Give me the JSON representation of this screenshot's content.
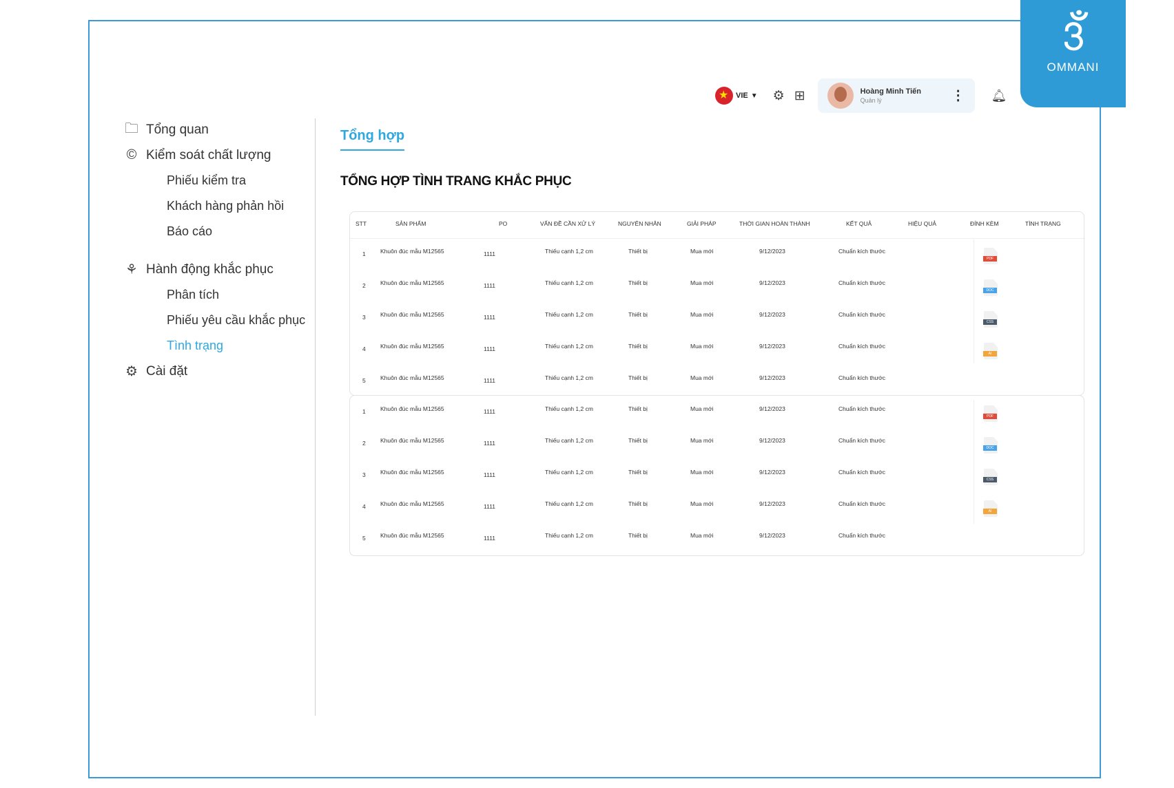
{
  "brand": {
    "mark": "3ઁ",
    "name": "OMMANI",
    "color": "#2f9bd6"
  },
  "topbar": {
    "language": "VIE",
    "user_name": "Hoàng Minh Tiến",
    "user_role": "Quản lý"
  },
  "sidebar": {
    "overview": "Tổng quan",
    "quality": "Kiểm soát chất lượng",
    "quality_items": [
      "Phiếu kiểm tra",
      "Khách hàng phản hồi",
      "Báo cáo"
    ],
    "corrective": "Hành động khắc phục",
    "corrective_items": [
      "Phân tích",
      "Phiếu yêu cầu khắc phục",
      "Tình trạng"
    ],
    "settings": "Cài đặt"
  },
  "main": {
    "tab": "Tổng hợp",
    "title": "TỔNG HỢP TÌNH TRANG KHẮC PHỤC",
    "columns": [
      "STT",
      "SẢN PHẨM",
      "PO",
      "VẤN ĐỀ CẦN XỬ LÝ",
      "NGUYÊN NHÂN",
      "GIẢI PHÁP",
      "THỜI GIAN HOÀN THÀNH",
      "KẾT QUẢ",
      "HIỆU QUẢ",
      "ĐÍNH KÈM",
      "TÌNH TRẠNG"
    ],
    "rows": [
      {
        "stt": "1",
        "product": "Khuôn đúc mẫu M12565",
        "po": "1111",
        "issue": "Thiếu cạnh 1,2 cm",
        "cause": "Thiết bị",
        "solution": "Mua mới",
        "time": "9/12/2023",
        "result": "Chuẩn kích thước",
        "file": "PDF"
      },
      {
        "stt": "2",
        "product": "Khuôn đúc mẫu M12565",
        "po": "1111",
        "issue": "Thiếu cạnh 1,2 cm",
        "cause": "Thiết bị",
        "solution": "Mua mới",
        "time": "9/12/2023",
        "result": "Chuẩn kích thước",
        "file": "DOC"
      },
      {
        "stt": "3",
        "product": "Khuôn đúc mẫu M12565",
        "po": "1111",
        "issue": "Thiếu cạnh 1,2 cm",
        "cause": "Thiết bị",
        "solution": "Mua mới",
        "time": "9/12/2023",
        "result": "Chuẩn kích thước",
        "file": "CSS"
      },
      {
        "stt": "4",
        "product": "Khuôn đúc mẫu M12565",
        "po": "1111",
        "issue": "Thiếu cạnh 1,2 cm",
        "cause": "Thiết bị",
        "solution": "Mua mới",
        "time": "9/12/2023",
        "result": "Chuẩn kích thước",
        "file": "AI"
      },
      {
        "stt": "5",
        "product": "Khuôn đúc mẫu M12565",
        "po": "1111",
        "issue": "Thiếu cạnh 1,2 cm",
        "cause": "Thiết bị",
        "solution": "Mua mới",
        "time": "9/12/2023",
        "result": "Chuẩn kích thước",
        "file": ""
      }
    ],
    "rows2": [
      {
        "stt": "1",
        "product": "Khuôn đúc mẫu M12565",
        "po": "1111",
        "issue": "Thiếu cạnh 1,2 cm",
        "cause": "Thiết bị",
        "solution": "Mua mới",
        "time": "9/12/2023",
        "result": "Chuẩn kích thước",
        "file": "PDF"
      },
      {
        "stt": "2",
        "product": "Khuôn đúc mẫu M12565",
        "po": "1111",
        "issue": "Thiếu cạnh 1,2 cm",
        "cause": "Thiết bị",
        "solution": "Mua mới",
        "time": "9/12/2023",
        "result": "Chuẩn kích thước",
        "file": "DOC"
      },
      {
        "stt": "3",
        "product": "Khuôn đúc mẫu M12565",
        "po": "1111",
        "issue": "Thiếu cạnh 1,2 cm",
        "cause": "Thiết bị",
        "solution": "Mua mới",
        "time": "9/12/2023",
        "result": "Chuẩn kích thước",
        "file": "CSS"
      },
      {
        "stt": "4",
        "product": "Khuôn đúc mẫu M12565",
        "po": "1111",
        "issue": "Thiếu cạnh 1,2 cm",
        "cause": "Thiết bị",
        "solution": "Mua mới",
        "time": "9/12/2023",
        "result": "Chuẩn kích thước",
        "file": "AI"
      },
      {
        "stt": "5",
        "product": "Khuôn đúc mẫu M12565",
        "po": "1111",
        "issue": "Thiếu cạnh 1,2 cm",
        "cause": "Thiết bị",
        "solution": "Mua mới",
        "time": "9/12/2023",
        "result": "Chuẩn kích thước",
        "file": ""
      }
    ]
  },
  "icons": {
    "overview": "folder-icon",
    "quality": "copyright-icon",
    "corrective": "hands-icon",
    "settings": "gear-icon"
  }
}
